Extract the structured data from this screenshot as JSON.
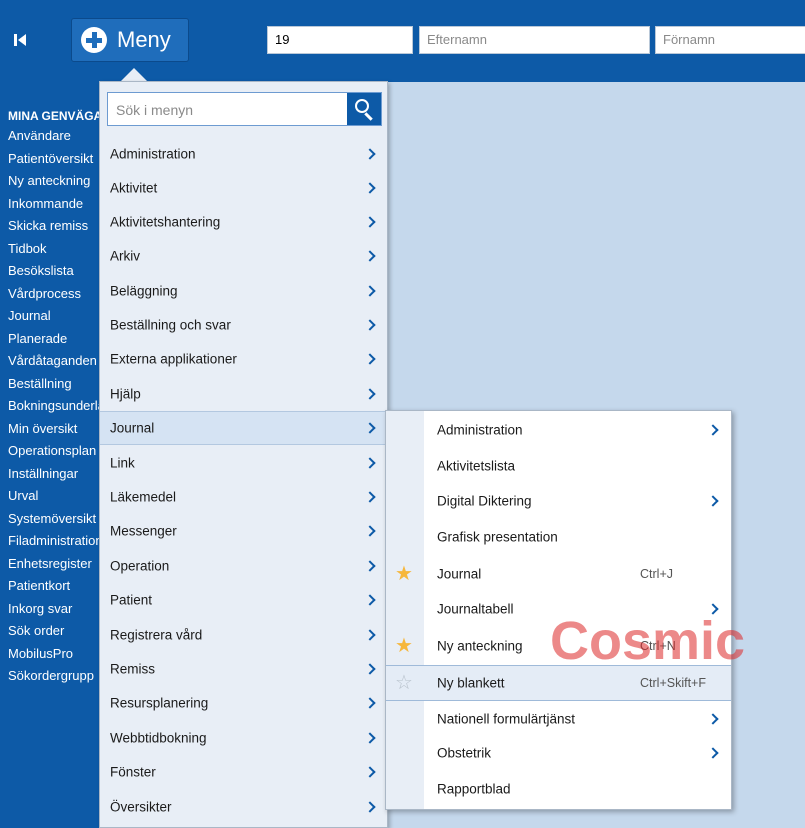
{
  "topbar": {
    "menu_label": "Meny",
    "pnr_value": "19",
    "lastname_placeholder": "Efternamn",
    "firstname_placeholder": "Förnamn"
  },
  "sidebar": {
    "heading": "MINA GENVÄGAR",
    "items": [
      "Användare",
      "Patientöversikt",
      "Ny anteckning",
      "Inkommande",
      "Skicka remiss",
      "Tidbok",
      "Besökslista",
      "Vårdprocess",
      "Journal",
      "Planerade",
      "Vårdåtaganden",
      "Beställning",
      "Bokningsunderlag",
      "Min översikt",
      "Operationsplan",
      "Inställningar",
      "Urval",
      "Systemöversikt",
      "Filadministration",
      "Enhetsregister",
      "Patientkort",
      "Inkorg svar",
      "Sök order",
      "MobilusPro",
      "Sökordergrupp"
    ]
  },
  "main_menu": {
    "search_placeholder": "Sök i menyn",
    "selected": "Journal",
    "items": [
      "Administration",
      "Aktivitet",
      "Aktivitetshantering",
      "Arkiv",
      "Beläggning",
      "Beställning och svar",
      "Externa applikationer",
      "Hjälp",
      "Journal",
      "Link",
      "Läkemedel",
      "Messenger",
      "Operation",
      "Patient",
      "Registrera vård",
      "Remiss",
      "Resursplanering",
      "Webbtidbokning",
      "Fönster",
      "Översikter"
    ]
  },
  "sub_menu": {
    "hovered": "Ny blankett",
    "items": [
      {
        "label": "Administration",
        "shortcut": "",
        "submenu": true,
        "star": "none"
      },
      {
        "label": "Aktivitetslista",
        "shortcut": "",
        "submenu": false,
        "star": "none"
      },
      {
        "label": "Digital Diktering",
        "shortcut": "",
        "submenu": true,
        "star": "none"
      },
      {
        "label": "Grafisk presentation",
        "shortcut": "",
        "submenu": false,
        "star": "none"
      },
      {
        "label": "Journal",
        "shortcut": "Ctrl+J",
        "submenu": false,
        "star": "filled"
      },
      {
        "label": "Journaltabell",
        "shortcut": "",
        "submenu": true,
        "star": "none"
      },
      {
        "label": "Ny anteckning",
        "shortcut": "Ctrl+N",
        "submenu": false,
        "star": "filled"
      },
      {
        "label": "Ny blankett",
        "shortcut": "Ctrl+Skift+F",
        "submenu": false,
        "star": "outline"
      },
      {
        "label": "Nationell formulärtjänst",
        "shortcut": "",
        "submenu": true,
        "star": "none"
      },
      {
        "label": "Obstetrik",
        "shortcut": "",
        "submenu": true,
        "star": "none"
      },
      {
        "label": "Rapportblad",
        "shortcut": "",
        "submenu": false,
        "star": "none"
      }
    ]
  },
  "watermark": "Cosmic",
  "colors": {
    "brand_blue": "#0d5aa7",
    "menu_bg": "#e8eef6",
    "star": "#f6b73c"
  }
}
